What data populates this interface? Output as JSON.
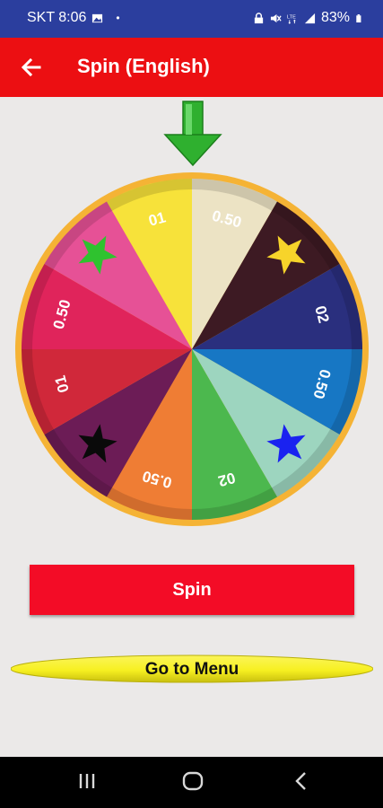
{
  "status_bar": {
    "carrier_time": "SKT 8:06",
    "dot": "•",
    "battery": "83%",
    "icons": [
      "image-icon",
      "lock-icon",
      "mute-icon",
      "lte-icon",
      "signal-icon",
      "battery-icon"
    ]
  },
  "app_bar": {
    "title": "Spin (English)",
    "back_icon": "arrow-left-icon",
    "color": "#ec0f12"
  },
  "wheel": {
    "pointer_color": "#2fb02f",
    "rim_color": "#f5b335",
    "segments": [
      {
        "label": "0.50",
        "type": "text",
        "color": "#ece3c4"
      },
      {
        "label": "star",
        "type": "star",
        "color": "#3d1a23",
        "star_color": "#f7d42a"
      },
      {
        "label": "02",
        "type": "text",
        "color": "#2a2f7e"
      },
      {
        "label": "0.50",
        "type": "text",
        "color": "#1777c4"
      },
      {
        "label": "star",
        "type": "star",
        "color": "#9dd5bf",
        "star_color": "#1a22f0"
      },
      {
        "label": "02",
        "type": "text",
        "color": "#4cb84e"
      },
      {
        "label": "0.50",
        "type": "text",
        "color": "#ef7d34"
      },
      {
        "label": "star",
        "type": "star",
        "color": "#6c1c56",
        "star_color": "#0a0a0a"
      },
      {
        "label": "01",
        "type": "text",
        "color": "#d0283a"
      },
      {
        "label": "0.50",
        "type": "text",
        "color": "#e0245b"
      },
      {
        "label": "star",
        "type": "star",
        "color": "#e65196",
        "star_color": "#2fc22f"
      },
      {
        "label": "01",
        "type": "text",
        "color": "#f7e23a"
      }
    ]
  },
  "buttons": {
    "spin_label": "Spin",
    "menu_label": "Go to Menu",
    "spin_color": "#f30c26",
    "menu_color": "#f7f021"
  },
  "nav_bar": {
    "icons": [
      "recents-icon",
      "home-icon",
      "back-icon"
    ]
  }
}
